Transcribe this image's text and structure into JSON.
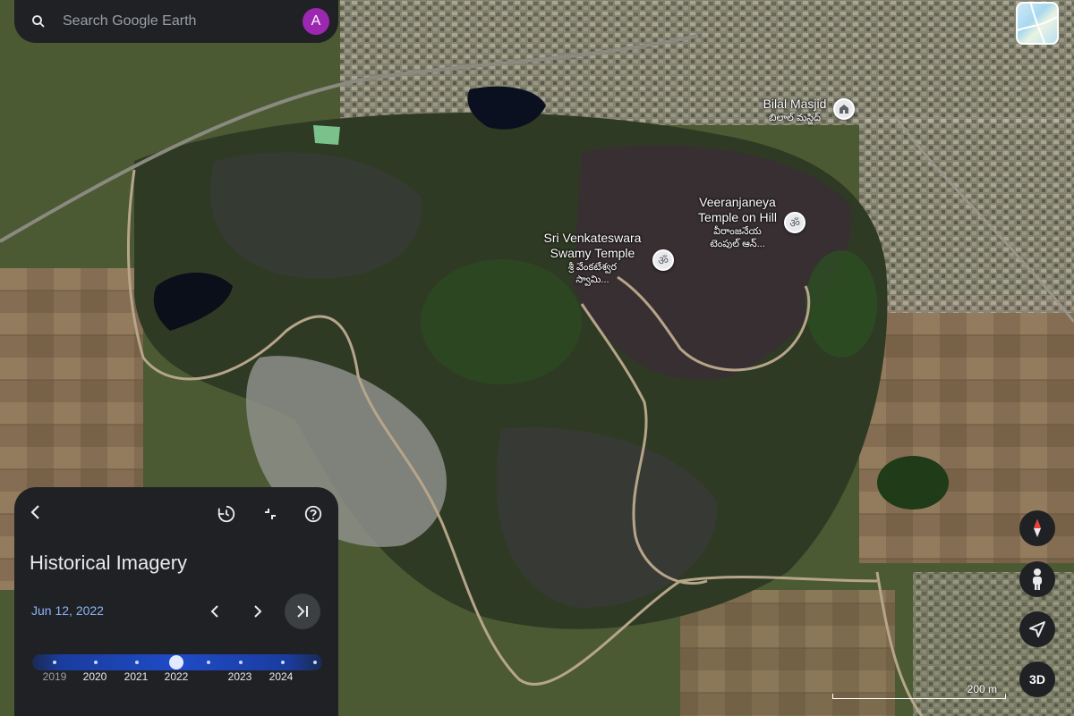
{
  "search": {
    "placeholder": "Search Google Earth",
    "avatar_letter": "A"
  },
  "places": {
    "masjid": {
      "name": "Bilal Masjid",
      "local": "బిలాల్ మస్జిద్"
    },
    "veeranjaneya": {
      "name_line1": "Veeranjaneya",
      "name_line2": "Temple on Hill",
      "local_line1": "వీరాంజనేయ",
      "local_line2": "టెంపుల్ ఆన్..."
    },
    "venkateswara": {
      "name_line1": "Sri Venkateswara",
      "name_line2": "Swamy Temple",
      "local_line1": "శ్రీ వేంకటేశ్వర",
      "local_line2": "స్వామి..."
    }
  },
  "controls": {
    "view_3d": "3D"
  },
  "scale": {
    "label": "200 m"
  },
  "panel": {
    "title": "Historical Imagery",
    "date": "Jun 12, 2022",
    "timeline": {
      "years": [
        "2019",
        "2020",
        "2021",
        "2022",
        "2023",
        "2024"
      ],
      "selected_year": "2022"
    }
  },
  "colors": {
    "accent": "#8ab4f8",
    "panel_bg": "#202124",
    "avatar": "#9c27b0"
  }
}
